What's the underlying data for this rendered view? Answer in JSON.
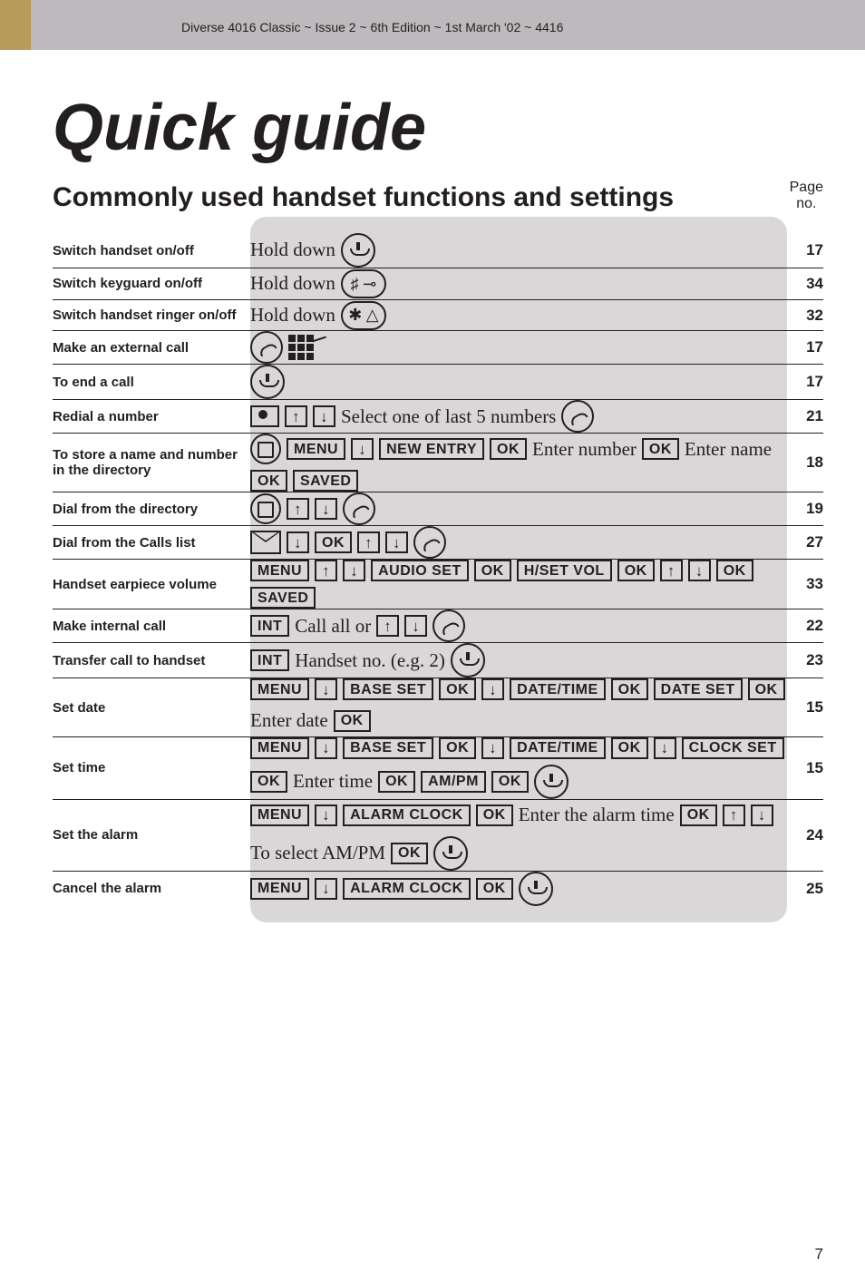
{
  "meta": {
    "header": "Diverse 4016 Classic ~ Issue 2 ~ 6th Edition ~ 1st March '02 ~ 4416",
    "page_number": "7"
  },
  "title": "Quick guide",
  "subtitle": "Commonly used handset functions and settings",
  "page_label": {
    "line1": "Page",
    "line2": "no."
  },
  "text": {
    "hold_down": "Hold down",
    "select_last5": "Select one of last 5 numbers",
    "enter_number": "Enter number",
    "enter_name": "Enter name",
    "call_all_or": "Call all or",
    "handset_no": "Handset no. (e.g. 2)",
    "enter_date": "Enter date",
    "enter_time": "Enter time",
    "enter_alarm": "Enter the alarm time",
    "to_select": "To select AM/PM"
  },
  "keys": {
    "MENU": "MENU",
    "OK": "OK",
    "INT": "INT",
    "NEW_ENTRY": "NEW ENTRY",
    "SAVED": "SAVED",
    "AUDIO_SET": "AUDIO SET",
    "HSET_VOL": "H/SET VOL",
    "BASE_SET": "BASE SET",
    "DATE_TIME": "DATE/TIME",
    "DATE_SET": "DATE SET",
    "CLOCK_SET": "CLOCK SET",
    "AMPM": "AM/PM",
    "ALARM_CLOCK": "ALARM CLOCK",
    "HASH": "♯ ⊸",
    "STAR": "✱ △"
  },
  "rows": [
    {
      "label": "Switch handset on/off",
      "page": "17"
    },
    {
      "label": "Switch keyguard on/off",
      "page": "34"
    },
    {
      "label": "Switch handset ringer on/off",
      "page": "32"
    },
    {
      "label": "Make an external call",
      "page": "17"
    },
    {
      "label": "To end a call",
      "page": "17"
    },
    {
      "label": "Redial a number",
      "page": "21"
    },
    {
      "label": "To store a name and number in  the directory",
      "page": "18"
    },
    {
      "label": "Dial from the directory",
      "page": "19"
    },
    {
      "label": "Dial from the Calls list",
      "page": "27"
    },
    {
      "label": "Handset earpiece volume",
      "page": "33"
    },
    {
      "label": "Make internal call",
      "page": "22"
    },
    {
      "label": "Transfer call to handset",
      "page": "23"
    },
    {
      "label": "Set date",
      "page": "15"
    },
    {
      "label": "Set time",
      "page": "15"
    },
    {
      "label": "Set the alarm",
      "page": "24"
    },
    {
      "label": "Cancel the alarm",
      "page": "25"
    }
  ]
}
